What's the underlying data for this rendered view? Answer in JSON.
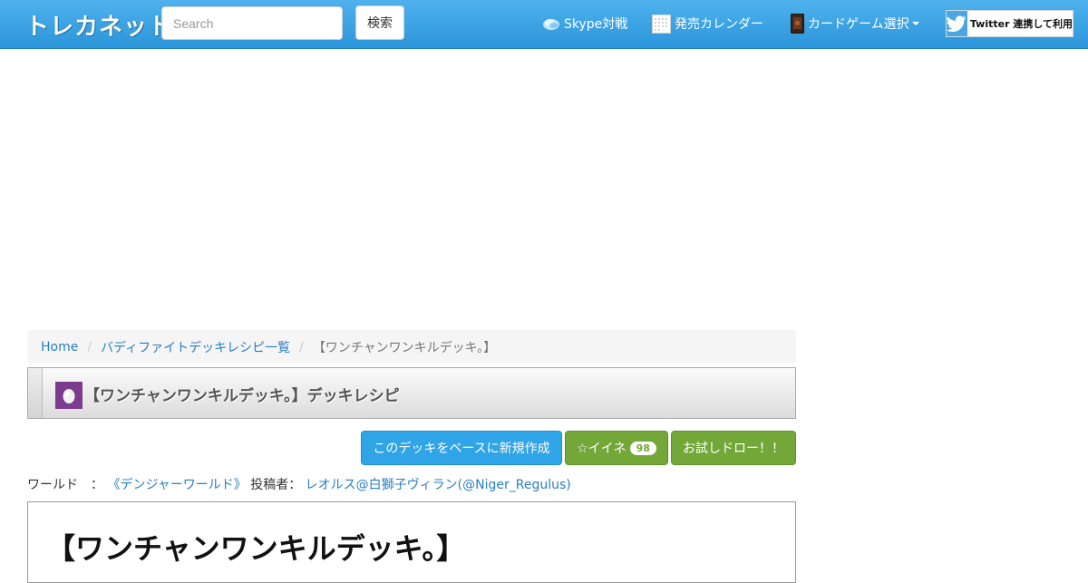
{
  "navbar": {
    "brand": "トレカネット",
    "search_placeholder": "Search",
    "search_button": "検索",
    "skype_label": "Skype対戦",
    "calendar_label": "発売カレンダー",
    "cardgame_label": "カードゲーム選択",
    "twitter_label": "Twitter 連携して利用"
  },
  "breadcrumb": {
    "home": "Home",
    "list": "バディファイトデッキレシピ一覧",
    "current": "【ワンチャンワンキルデッキ。】"
  },
  "title": {
    "text": "【ワンチャンワンキルデッキ。】デッキレシピ"
  },
  "actions": {
    "new_from_base": "このデッキをベースに新規作成",
    "like_label": "☆イイネ",
    "like_count": "98",
    "trial_draw": "お試しドロー！！"
  },
  "meta": {
    "world_label": "ワールド　：",
    "world_value": "《デンジャーワールド》",
    "poster_label": "投稿者：",
    "poster_value": "レオルス@白獅子ヴィラン(@Niger_Regulus)"
  },
  "deck_image": {
    "name": "【ワンチャンワンキルデッキ。】"
  },
  "colors": {
    "navbar": "#2b95d9",
    "primary_button": "#2fa4e7",
    "success_button": "#73a839",
    "link": "#2a7fc0"
  }
}
